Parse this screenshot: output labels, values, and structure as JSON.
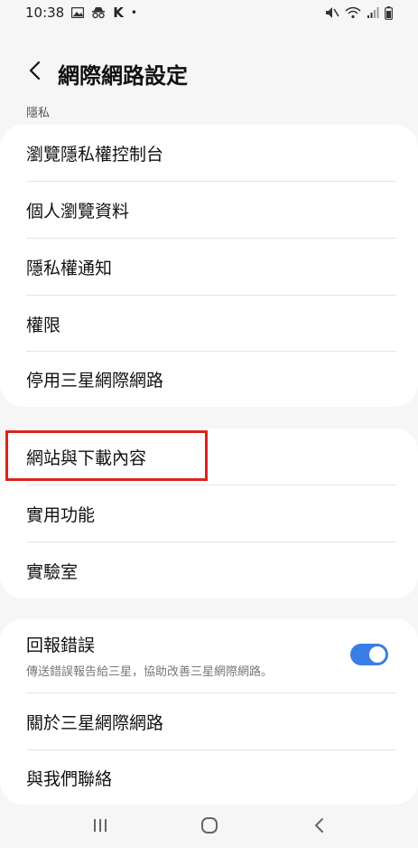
{
  "status_bar": {
    "time": "10:38",
    "carrier_letter": "K",
    "dot": "•"
  },
  "header": {
    "title": "網際網路設定"
  },
  "privacy_section": {
    "label": "隱私",
    "items": [
      {
        "label": "瀏覽隱私權控制台"
      },
      {
        "label": "個人瀏覽資料"
      },
      {
        "label": "隱私權通知"
      },
      {
        "label": "權限"
      },
      {
        "label": "停用三星網際網路"
      }
    ]
  },
  "general_section": {
    "items": [
      {
        "label": "網站與下載內容"
      },
      {
        "label": "實用功能"
      },
      {
        "label": "實驗室"
      }
    ]
  },
  "about_section": {
    "report_errors": {
      "label": "回報錯誤",
      "description": "傳送錯誤報告給三星，協助改善三星網際網路。",
      "enabled": true
    },
    "items": [
      {
        "label": "關於三星網際網路"
      },
      {
        "label": "與我們聯絡"
      }
    ]
  },
  "colors": {
    "accent": "#3b7de6",
    "highlight_border": "#d9251c",
    "background": "#f6f6f6",
    "card": "#ffffff"
  },
  "icons": {
    "back": "chevron-left-icon",
    "nav_recents": "recents-icon",
    "nav_home": "home-icon",
    "nav_back": "back-icon"
  }
}
